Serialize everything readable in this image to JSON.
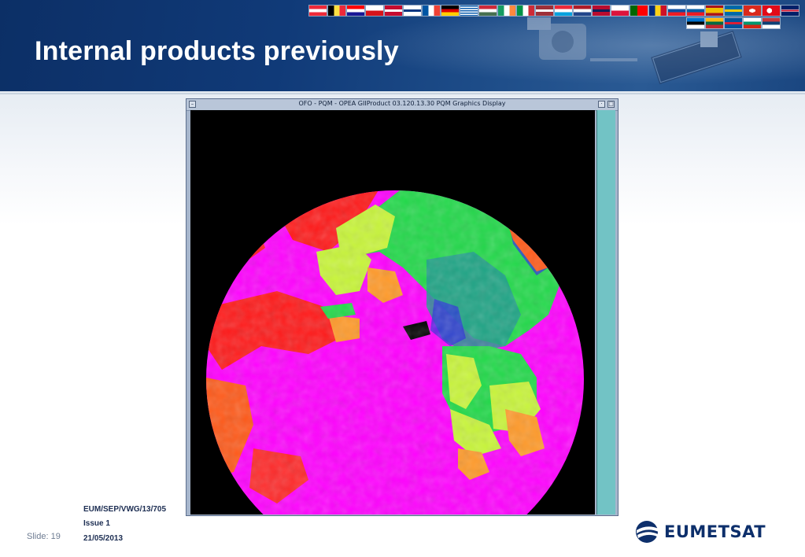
{
  "slide": {
    "title": "Internal products previously",
    "slide_prefix": "Slide:",
    "slide_number": "19",
    "document_ref": "EUM/SEP/VWG/13/705",
    "issue": "Issue 1",
    "date": "21/05/2013",
    "logo_text": "EUMETSAT"
  },
  "window": {
    "title": "OFO - PQM - OPEA GIIProduct 03.120.13.30 PQM Graphics Display",
    "menu_button_glyph": "–",
    "minimize_glyph": "·",
    "maximize_glyph": "□"
  },
  "colors": {
    "banner_dark": "#0c2f66",
    "title_text": "#ffffff",
    "footer_text": "#1c2d52",
    "window_frame": "#a7b6cc",
    "scrollbar": "#72c3c5",
    "globe_magenta": "#ff00ff",
    "globe_red": "#ff1a1a",
    "globe_green": "#22d94a",
    "globe_yellowgreen": "#c8f53a",
    "globe_teal": "#1f9a8f",
    "globe_blue": "#2a2ae0",
    "globe_orange": "#ff9a2a"
  },
  "flags": [
    "austria-flag",
    "belgium-flag",
    "croatia-flag",
    "czech-flag",
    "denmark-flag",
    "finland-flag",
    "france-flag",
    "germany-flag",
    "greece-flag",
    "hungary-flag",
    "ireland-flag",
    "italy-flag",
    "latvia-flag",
    "luxembourg-flag",
    "netherlands-flag",
    "norway-flag",
    "poland-flag",
    "portugal-flag",
    "romania-flag",
    "slovakia-flag",
    "slovenia-flag",
    "spain-flag",
    "sweden-flag",
    "switzerland-flag",
    "turkey-flag",
    "united-kingdom-flag",
    "estonia-flag",
    "lithuania-flag",
    "iceland-flag",
    "bulgaria-flag",
    "serbia-flag"
  ]
}
